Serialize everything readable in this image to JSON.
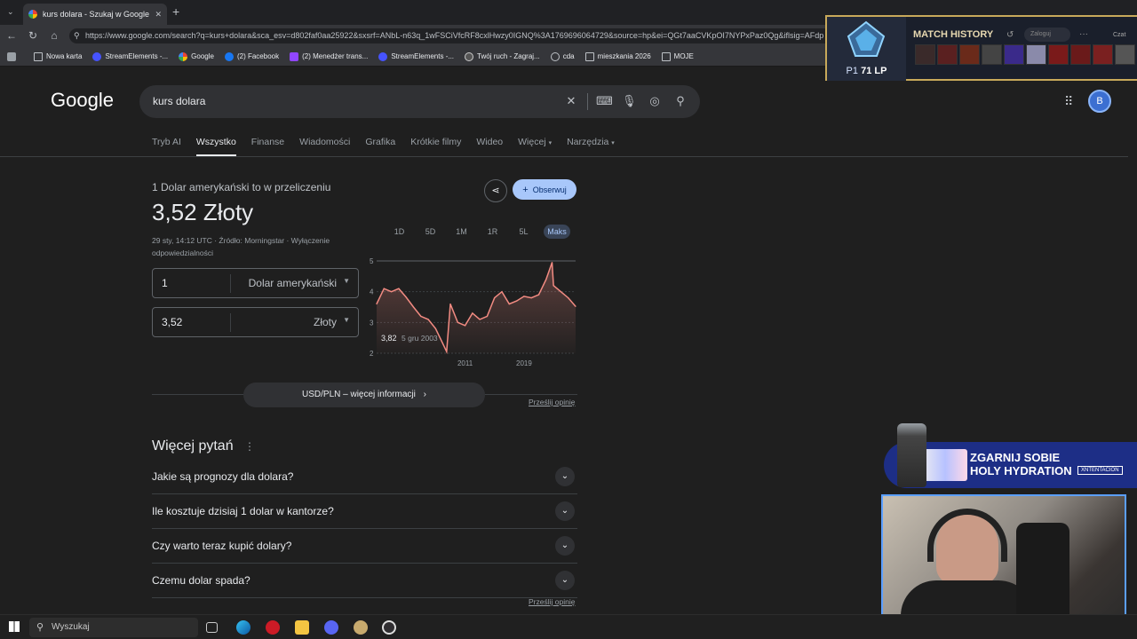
{
  "browser": {
    "tab_title": "kurs dolara - Szukaj w Google",
    "url": "https://www.google.com/search?q=kurs+dolara&sca_esv=d802faf0aa25922&sxsrf=ANbL-n63q_1wFSCiVfcRF8cxlHwzy0IGNQ%3A1769696064729&source=hp&ei=QGt7aaCVKpOI7NYPxPaz0Qg&iflsig=AFdp",
    "bookmarks": [
      "Nowa karta",
      "StreamElements -...",
      "Google",
      "(2) Facebook",
      "(2) Menedżer trans...",
      "StreamElements -...",
      "Twój ruch - Zagraj...",
      "cda",
      "mieszkania 2026",
      "MOJE"
    ]
  },
  "search": {
    "logo": "Google",
    "query": "kurs dolara",
    "avatar_letter": "B",
    "tabs": [
      "Tryb AI",
      "Wszystko",
      "Finanse",
      "Wiadomości",
      "Grafika",
      "Krótkie filmy",
      "Wideo",
      "Więcej",
      "Narzędzia"
    ],
    "active_tab": "Wszystko"
  },
  "finance": {
    "title": "1 Dolar amerykański to w przeliczeniu",
    "value": "3,52 Złoty",
    "meta": "29 sty, 14:12 UTC · Źródło: Morningstar · Wyłączenie odpowiedzialności",
    "follow_label": "Obserwuj",
    "from_amount": "1",
    "from_currency": "Dolar amerykański",
    "to_amount": "3,52",
    "to_currency": "Złoty",
    "ranges": [
      "1D",
      "5D",
      "1M",
      "1R",
      "5L",
      "Maks"
    ],
    "selected_range": "Maks",
    "tooltip_value": "3,82",
    "tooltip_date": "5 gru 2003",
    "more_info": "USD/PLN – więcej informacji",
    "feedback": "Prześlij opinię"
  },
  "chart_data": {
    "type": "area",
    "title": "",
    "xlabel": "",
    "ylabel": "",
    "ylim": [
      2,
      5
    ],
    "yticks": [
      "5",
      "4",
      "3",
      "2"
    ],
    "xticks": [
      "2011",
      "2019"
    ],
    "x": [
      1999,
      2000,
      2001,
      2002,
      2003,
      2004,
      2005,
      2006,
      2007,
      2008,
      2008.5,
      2009,
      2010,
      2011,
      2012,
      2013,
      2014,
      2015,
      2016,
      2017,
      2018,
      2019,
      2020,
      2021,
      2022,
      2022.8,
      2023,
      2024,
      2025,
      2026
    ],
    "values": [
      3.6,
      4.1,
      4.0,
      4.1,
      3.82,
      3.5,
      3.2,
      3.1,
      2.8,
      2.3,
      2.05,
      3.6,
      3.0,
      2.9,
      3.3,
      3.1,
      3.2,
      3.8,
      4.0,
      3.6,
      3.7,
      3.85,
      3.8,
      3.9,
      4.4,
      4.95,
      4.2,
      4.0,
      3.8,
      3.52
    ],
    "line_color": "#f28b82"
  },
  "paa": {
    "title": "Więcej pytań",
    "questions": [
      "Jakie są prognozy dla dolara?",
      "Ile kosztuje dzisiaj 1 dolar w kantorze?",
      "Czy warto teraz kupić dolary?",
      "Czemu dolar spada?"
    ],
    "feedback": "Prześlij opinię"
  },
  "overlay": {
    "match_history": "MATCH HISTORY",
    "rank_prefix": "P1",
    "lp": "71 LP",
    "login": "Zaloguj",
    "chat": "Czat",
    "promo_line1": "ZGARNIJ SOBIE",
    "promo_line2": "HOLY HYDRATION",
    "promo_tag": "XNTENTACION"
  },
  "taskbar": {
    "search_placeholder": "Wyszukaj"
  }
}
